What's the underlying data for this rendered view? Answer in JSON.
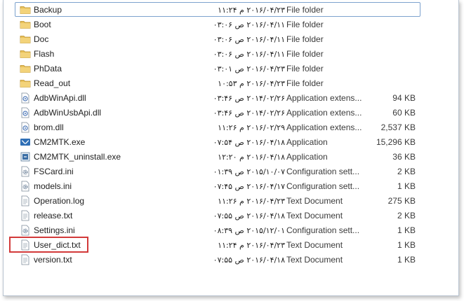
{
  "files": [
    {
      "name": "Backup",
      "date": "۲۰۱۶/۰۴/۲۳ م ۱۱:۲۴",
      "type": "File folder",
      "size": "",
      "icon": "folder-icon",
      "selected": true
    },
    {
      "name": "Boot",
      "date": "۲۰۱۶/۰۴/۱۱ ص ۰۳:۰۶",
      "type": "File folder",
      "size": "",
      "icon": "folder-icon"
    },
    {
      "name": "Doc",
      "date": "۲۰۱۶/۰۴/۱۱ ص ۰۳:۰۶",
      "type": "File folder",
      "size": "",
      "icon": "folder-icon"
    },
    {
      "name": "Flash",
      "date": "۲۰۱۶/۰۴/۱۱ ص ۰۳:۰۶",
      "type": "File folder",
      "size": "",
      "icon": "folder-icon"
    },
    {
      "name": "PhData",
      "date": "۲۰۱۶/۰۴/۲۳ ص ۰۳:۰۱",
      "type": "File folder",
      "size": "",
      "icon": "folder-icon"
    },
    {
      "name": "Read_out",
      "date": "۲۰۱۶/۰۴/۲۳ م ۱۰:۵۳",
      "type": "File folder",
      "size": "",
      "icon": "folder-icon"
    },
    {
      "name": "AdbWinApi.dll",
      "date": "۲۰۱۴/۰۲/۲۶ ص ۰۳:۴۶",
      "type": "Application extens...",
      "size": "94 KB",
      "icon": "dll-icon"
    },
    {
      "name": "AdbWinUsbApi.dll",
      "date": "۲۰۱۴/۰۲/۲۶ ص ۰۳:۴۶",
      "type": "Application extens...",
      "size": "60 KB",
      "icon": "dll-icon"
    },
    {
      "name": "brom.dll",
      "date": "۲۰۱۶/۰۲/۲۹ م ۱۱:۲۶",
      "type": "Application extens...",
      "size": "2,537 KB",
      "icon": "dll-icon"
    },
    {
      "name": "CM2MTK.exe",
      "date": "۲۰۱۶/۰۴/۱۸ ص ۰۷:۵۴",
      "type": "Application",
      "size": "15,296 KB",
      "icon": "cm2mtk-app-icon"
    },
    {
      "name": "CM2MTK_uninstall.exe",
      "date": "۲۰۱۶/۰۴/۱۸ م ۱۲:۲۰",
      "type": "Application",
      "size": "36 KB",
      "icon": "uninstall-app-icon"
    },
    {
      "name": "FSCard.ini",
      "date": "۲۰۱۵/۱۰/۰۷ ص ۰۱:۳۹",
      "type": "Configuration sett...",
      "size": "2 KB",
      "icon": "config-icon"
    },
    {
      "name": "models.ini",
      "date": "۲۰۱۶/۰۴/۱۷ ص ۰۷:۴۵",
      "type": "Configuration sett...",
      "size": "1 KB",
      "icon": "config-icon"
    },
    {
      "name": "Operation.log",
      "date": "۲۰۱۶/۰۴/۲۳ م ۱۱:۲۶",
      "type": "Text Document",
      "size": "275 KB",
      "icon": "text-document-icon"
    },
    {
      "name": "release.txt",
      "date": "۲۰۱۶/۰۴/۱۸ ص ۰۷:۵۵",
      "type": "Text Document",
      "size": "2 KB",
      "icon": "text-document-icon"
    },
    {
      "name": "Settings.ini",
      "date": "۲۰۱۵/۱۲/۰۱ ص ۰۸:۳۹",
      "type": "Configuration sett...",
      "size": "1 KB",
      "icon": "config-icon"
    },
    {
      "name": "User_dict.txt",
      "date": "۲۰۱۶/۰۴/۲۳ م ۱۱:۲۴",
      "type": "Text Document",
      "size": "1 KB",
      "icon": "text-document-icon"
    },
    {
      "name": "version.txt",
      "date": "۲۰۱۶/۰۴/۱۸ ص ۰۷:۵۵",
      "type": "Text Document",
      "size": "1 KB",
      "icon": "text-document-icon"
    }
  ],
  "colors": {
    "selection_border": "#7da2ce",
    "highlight_box": "#d23a3a",
    "folder": "#e8c15a"
  }
}
